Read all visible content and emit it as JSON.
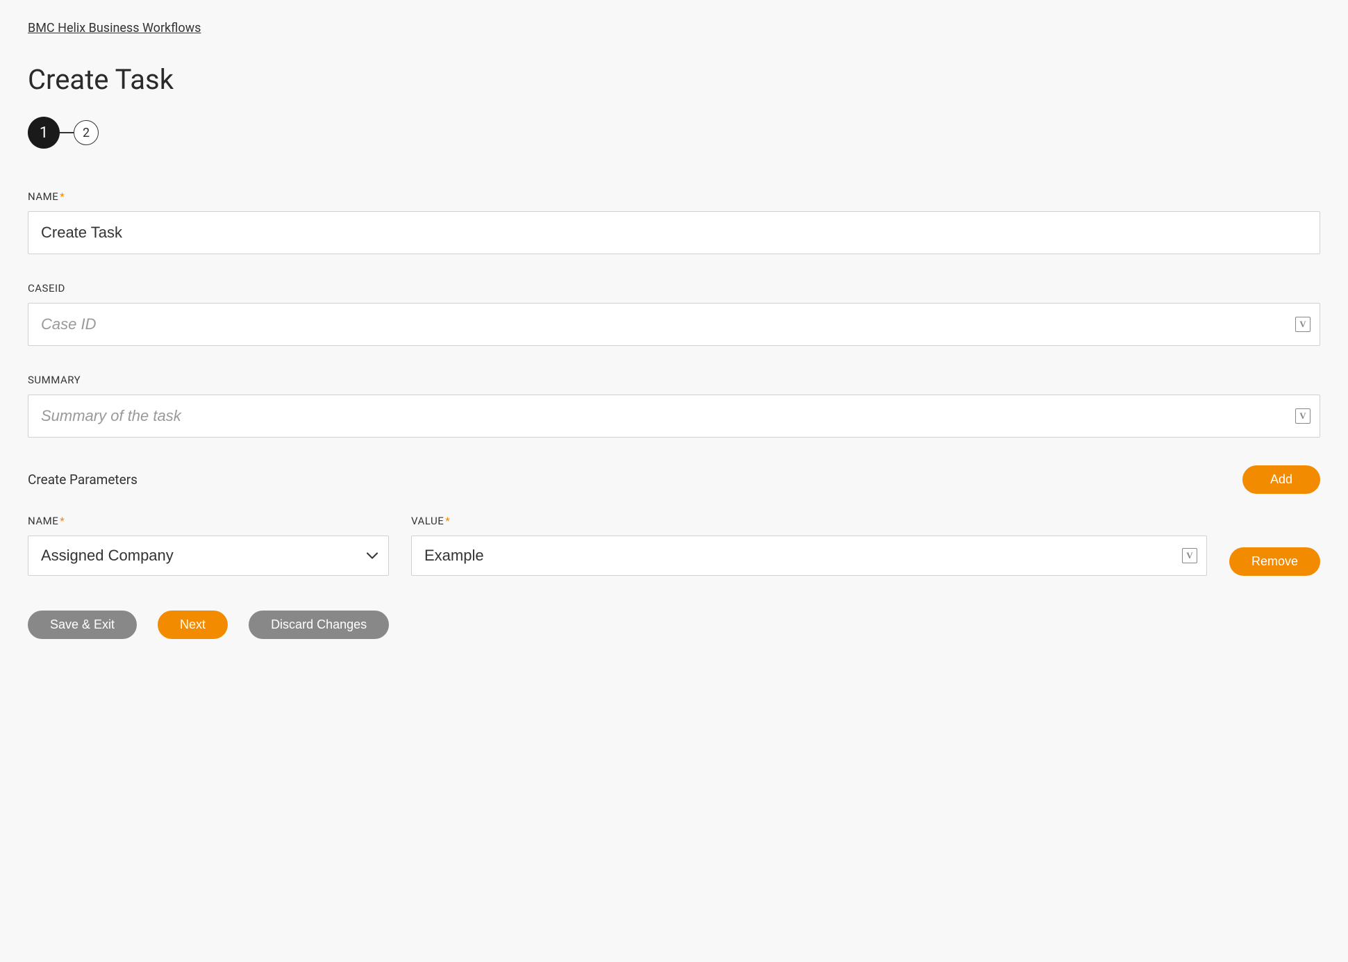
{
  "breadcrumb": "BMC Helix Business Workflows",
  "page_title": "Create Task",
  "stepper": {
    "step1": "1",
    "step2": "2"
  },
  "fields": {
    "name": {
      "label": "NAME",
      "value": "Create Task"
    },
    "caseid": {
      "label": "CASEID",
      "placeholder": "Case ID"
    },
    "summary": {
      "label": "SUMMARY",
      "placeholder": "Summary of the task"
    }
  },
  "parameters": {
    "section_label": "Create Parameters",
    "add_button": "Add",
    "row": {
      "name_label": "NAME",
      "name_value": "Assigned Company",
      "value_label": "VALUE",
      "value_value": "Example",
      "remove_button": "Remove"
    }
  },
  "footer": {
    "save_exit": "Save & Exit",
    "next": "Next",
    "discard": "Discard Changes"
  },
  "icons": {
    "variable": "V"
  }
}
